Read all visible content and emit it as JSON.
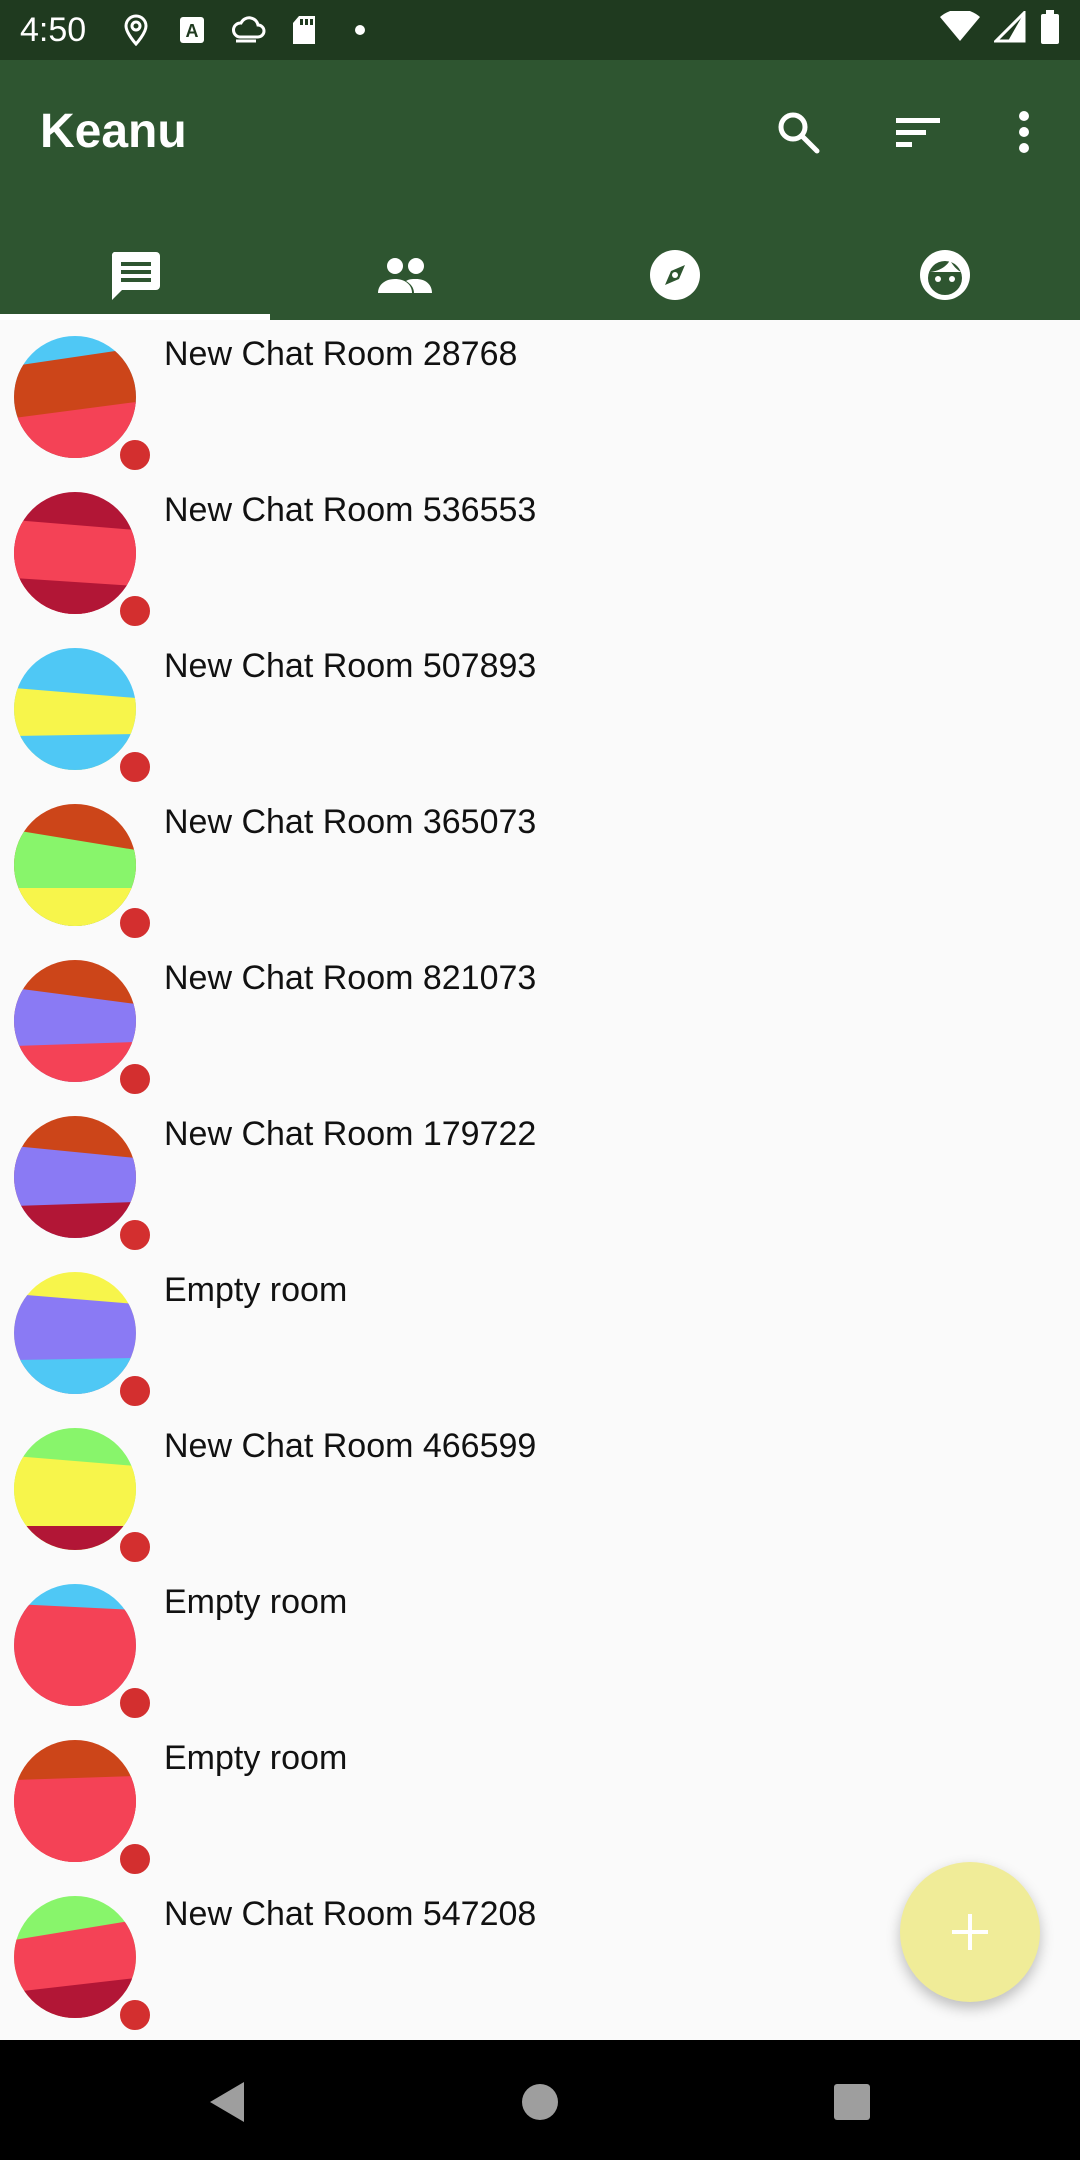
{
  "status_bar": {
    "time": "4:50",
    "icons": [
      "location-icon",
      "a-icon",
      "cloud-sync-icon",
      "sd-card-icon",
      "dot-icon",
      "wifi-icon",
      "signal-icon",
      "battery-icon"
    ]
  },
  "app_bar": {
    "title": "Keanu",
    "actions": [
      "search-icon",
      "sort-icon",
      "more-vert-icon"
    ],
    "background": "#2e5530"
  },
  "tabs": [
    {
      "name": "chats",
      "icon": "chat-icon",
      "active": true
    },
    {
      "name": "contacts",
      "icon": "people-icon",
      "active": false
    },
    {
      "name": "explore",
      "icon": "compass-icon",
      "active": false
    },
    {
      "name": "profile",
      "icon": "face-icon",
      "active": false
    }
  ],
  "rooms": [
    {
      "name": "New Chat Room 28768",
      "colors": [
        "#4fc8f5",
        "#cc4519",
        "#f44256"
      ]
    },
    {
      "name": "New Chat Room 536553",
      "colors": [
        "#b21636",
        "#f44256",
        "#b21636"
      ]
    },
    {
      "name": "New Chat Room 507893",
      "colors": [
        "#4fc8f5",
        "#f7f54b",
        "#4fc8f5"
      ]
    },
    {
      "name": "New Chat Room 365073",
      "colors": [
        "#cc4519",
        "#88f56b",
        "#f7f54b"
      ]
    },
    {
      "name": "New Chat Room 821073",
      "colors": [
        "#cc4519",
        "#8a7af4",
        "#f44256"
      ]
    },
    {
      "name": "New Chat Room 179722",
      "colors": [
        "#cc4519",
        "#8a7af4",
        "#b21636"
      ]
    },
    {
      "name": "Empty room",
      "colors": [
        "#f7f54b",
        "#8a7af4",
        "#4fc8f5"
      ]
    },
    {
      "name": "New Chat Room 466599",
      "colors": [
        "#88f56b",
        "#f7f54b",
        "#b21636"
      ]
    },
    {
      "name": "Empty room",
      "colors": [
        "#4fc8f5",
        "#f44256",
        "#f44256"
      ]
    },
    {
      "name": "Empty room",
      "colors": [
        "#cc4519",
        "#f44256",
        "#f44256"
      ]
    },
    {
      "name": "New Chat Room 547208",
      "colors": [
        "#88f56b",
        "#f44256",
        "#b21636"
      ]
    }
  ],
  "unread_color": "#d32f2f",
  "fab": {
    "icon": "plus-icon",
    "color": "#f0ec98"
  },
  "nav_bar": [
    "back-icon",
    "home-icon",
    "recents-icon"
  ]
}
